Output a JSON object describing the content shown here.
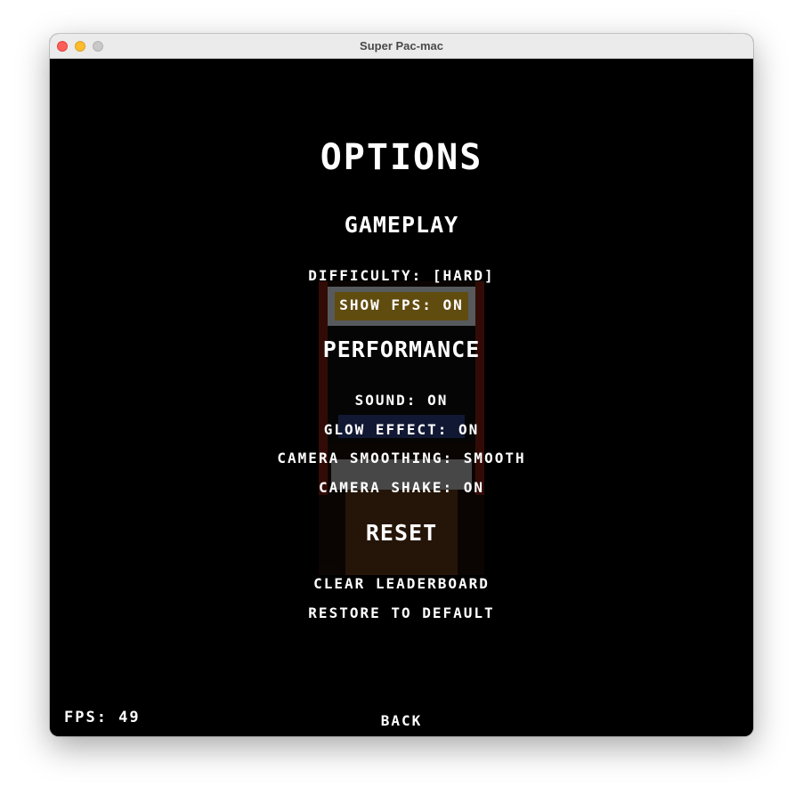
{
  "window": {
    "title": "Super Pac-mac"
  },
  "menu": {
    "title": "OPTIONS",
    "sections": {
      "gameplay": {
        "heading": "GAMEPLAY",
        "difficulty": "DIFFICULTY: [HARD]",
        "show_fps": "SHOW FPS: ON"
      },
      "performance": {
        "heading": "PERFORMANCE",
        "sound": "SOUND: ON",
        "glow_effect": "GLOW EFFECT: ON",
        "camera_smoothing": "CAMERA SMOOTHING: SMOOTH",
        "camera_shake": "CAMERA SHAKE: ON"
      },
      "reset": {
        "heading": "RESET",
        "clear_leaderboard": "CLEAR LEADERBOARD",
        "restore_default": "RESTORE TO DEFAULT"
      }
    },
    "back": "BACK"
  },
  "status": {
    "fps": "FPS: 49"
  },
  "colors": {
    "background": "#000000",
    "text": "#ffffff",
    "titlebar": "#ebebeb"
  },
  "icons": {
    "background_art": "arcade-cabinet-icon"
  }
}
